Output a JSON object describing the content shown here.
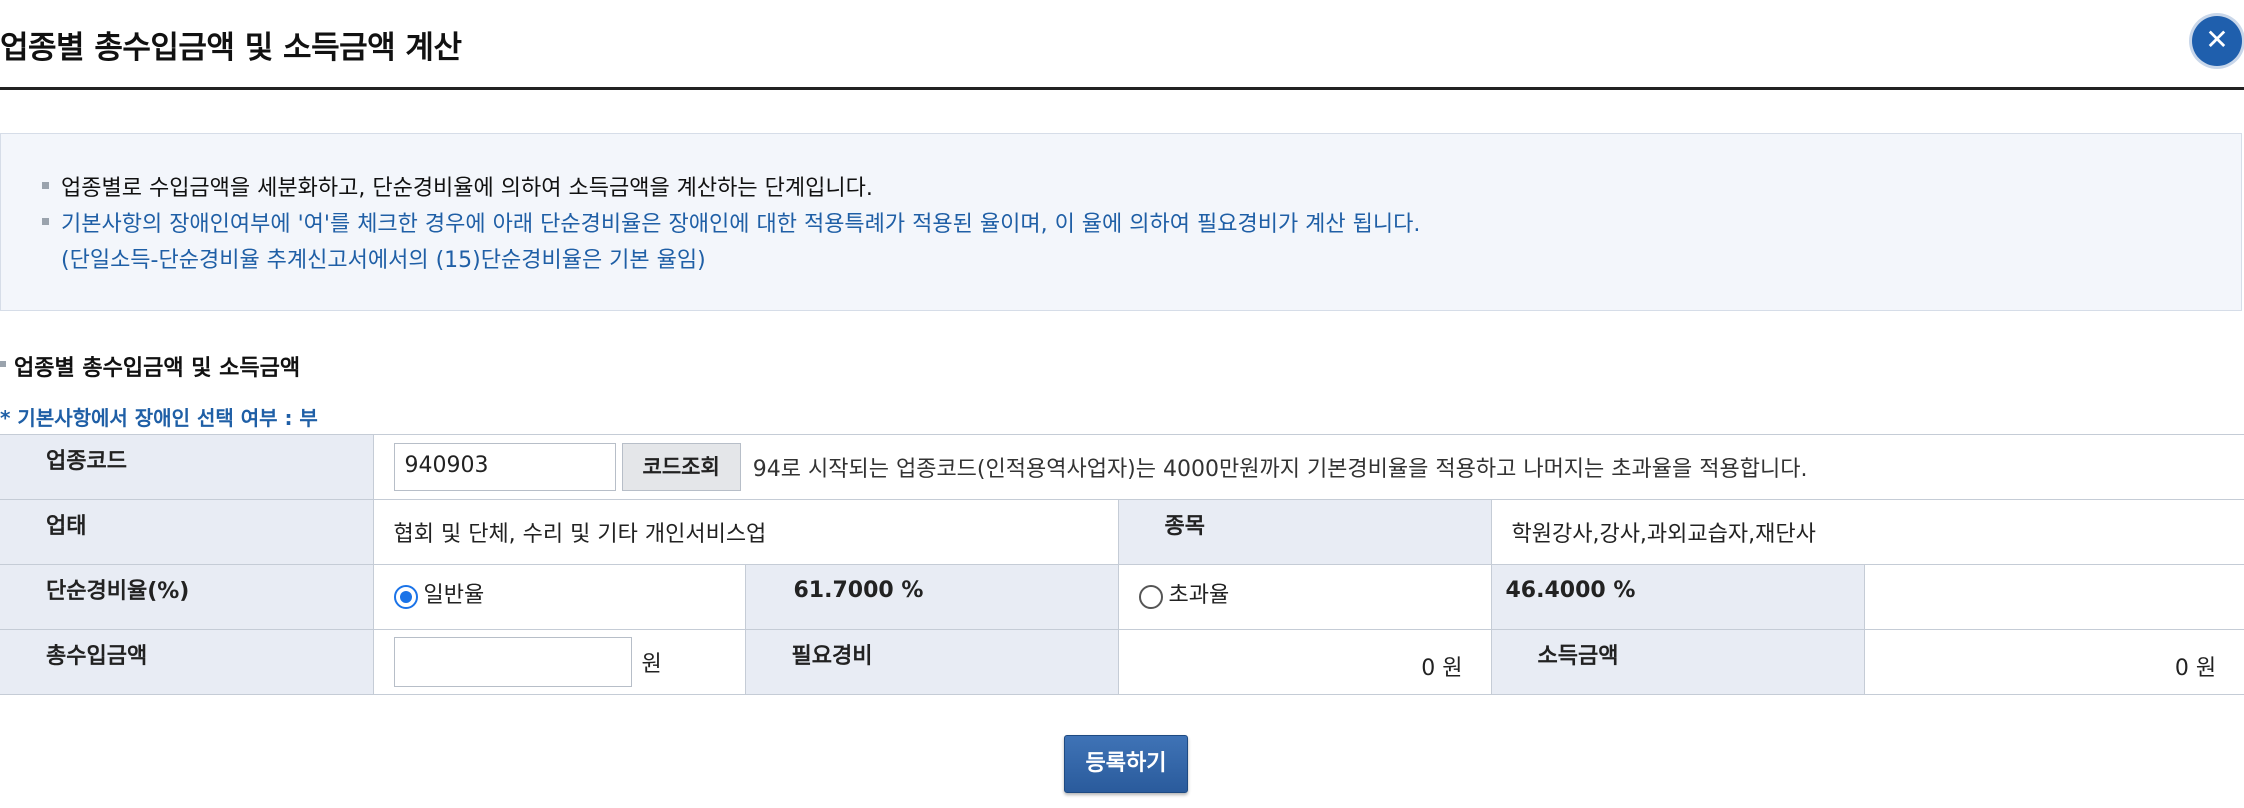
{
  "dialog": {
    "title": "업종별 총수입금액 및 소득금액 계산",
    "close_label": "✕"
  },
  "notice": {
    "line1": "업종별로 수입금액을 세분화하고, 단순경비율에 의하여 소득금액을 계산하는 단계입니다.",
    "line2": "기본사항의 장애인여부에 '여'를 체크한 경우에 아래 단순경비율은 장애인에 대한 적용특례가 적용된 율이며, 이 율에 의하여 필요경비가 계산 됩니다.",
    "line3": "(단일소득-단순경비율 추계신고서에서의 (15)단순경비율은 기본 율임)"
  },
  "section": {
    "title": "업종별 총수입금액 및 소득금액",
    "disabled_note": "* 기본사항에서 장애인 선택 여부 : 부"
  },
  "form": {
    "required_mark": "*",
    "industry_code_label": "업종코드",
    "industry_code_value": "940903",
    "code_lookup_button": "코드조회",
    "code_note": "94로 시작되는 업종코드(인적용역사업자)는 4000만원까지 기본경비율을 적용하고 나머지는 초과율을 적용합니다.",
    "business_type_label": "업태",
    "business_type_value": "협회 및 단체, 수리 및 기타 개인서비스업",
    "item_label": "종목",
    "item_value": "학원강사,강사,과외교습자,재단사",
    "rate_label": "단순경비율(%)",
    "rate_general_label": "일반율",
    "rate_general_value": "61.7000 %",
    "rate_excess_label": "초과율",
    "rate_excess_value": "46.4000 %",
    "selected_rate": "일반율",
    "total_income_label": "총수입금액",
    "total_income_value": "",
    "won_unit": "원",
    "expense_label": "필요경비",
    "expense_value": "0  원",
    "income_label": "소득금액",
    "income_value": "0  원"
  },
  "actions": {
    "submit_label": "등록하기"
  },
  "colors": {
    "accent": "#1f5fad",
    "header_cell_bg": "#e8ecf4",
    "notice_bg": "#f3f6fb",
    "required": "#d0021b"
  }
}
